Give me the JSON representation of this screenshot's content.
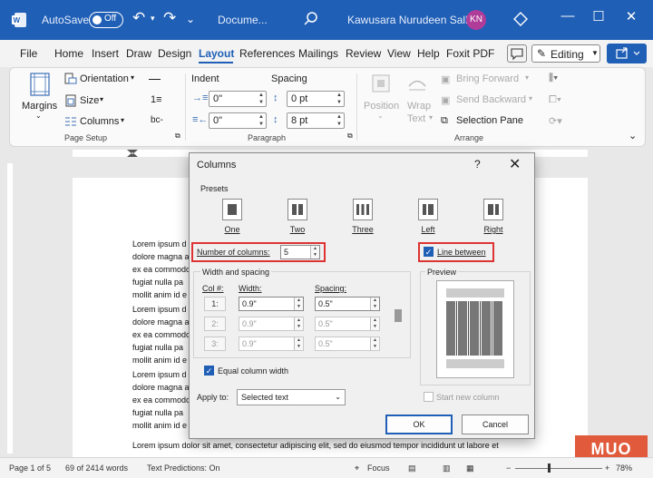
{
  "titlebar": {
    "autosave_label": "AutoSave",
    "autosave_state": "Off",
    "doc_name": "Docume...",
    "user_name": "Kawusara Nurudeen Salley",
    "user_initials": "KN"
  },
  "menu": {
    "tabs": [
      "File",
      "Home",
      "Insert",
      "Draw",
      "Design",
      "Layout",
      "References",
      "Mailings",
      "Review",
      "View",
      "Help",
      "Foxit PDF"
    ],
    "active_tab": "Layout",
    "editing_label": "Editing"
  },
  "ribbon": {
    "margins": "Margins",
    "orientation": "Orientation",
    "size": "Size",
    "columns": "Columns",
    "page_setup_group": "Page Setup",
    "indent_header": "Indent",
    "spacing_header": "Spacing",
    "indent_left": "0\"",
    "indent_right": "0\"",
    "spacing_before": "0 pt",
    "spacing_after": "8 pt",
    "paragraph_group": "Paragraph",
    "position": "Position",
    "wrap": "Wrap",
    "text": "Text",
    "bring_forward": "Bring Forward",
    "send_backward": "Send Backward",
    "selection_pane": "Selection Pane",
    "arrange_group": "Arrange"
  },
  "document": {
    "paragraphs": [
      [
        "Lorem ipsum d",
        "dolore magna a",
        "ex ea commodo",
        "fugiat nulla pa",
        "mollit anim id e"
      ],
      [
        "Lorem ipsum d",
        "dolore magna a",
        "ex ea commodo",
        "fugiat nulla pa",
        "mollit anim id e"
      ],
      [
        "Lorem ipsum d",
        "dolore magna a",
        "ex ea commodo",
        "fugiat nulla pa",
        "mollit anim id e"
      ]
    ],
    "bottom_line": "Lorem ipsum dolor sit amet, consectetur adipiscing elit, sed do eiusmod tempor incididunt ut labore et"
  },
  "dialog": {
    "title": "Columns",
    "help": "?",
    "presets_label": "Presets",
    "presets": [
      "One",
      "Two",
      "Three",
      "Left",
      "Right"
    ],
    "number_of_columns_label": "Number of columns:",
    "number_of_columns": "5",
    "line_between_label": "Line between",
    "line_between_checked": true,
    "width_spacing_label": "Width and spacing",
    "col_header": "Col #:",
    "width_header": "Width:",
    "spacing_header": "Spacing:",
    "rows": [
      {
        "col": "1:",
        "width": "0.9\"",
        "spacing": "0.5\"",
        "enabled": true
      },
      {
        "col": "2:",
        "width": "0.9\"",
        "spacing": "0.5\"",
        "enabled": false
      },
      {
        "col": "3:",
        "width": "0.9\"",
        "spacing": "0.5\"",
        "enabled": false
      }
    ],
    "preview_label": "Preview",
    "equal_width_label": "Equal column width",
    "equal_width_checked": true,
    "apply_to_label": "Apply to:",
    "apply_to_value": "Selected text",
    "start_new_column_label": "Start new column",
    "ok_label": "OK",
    "cancel_label": "Cancel"
  },
  "statusbar": {
    "page": "Page 1 of 5",
    "words": "69 of 2414 words",
    "predictions": "Text Predictions: On",
    "focus": "Focus",
    "zoom": "78%"
  },
  "watermark": "MUO",
  "colors": {
    "titlebar": "#1f5fb6",
    "highlight": "#dd3333",
    "avatar": "#b03c9a"
  }
}
